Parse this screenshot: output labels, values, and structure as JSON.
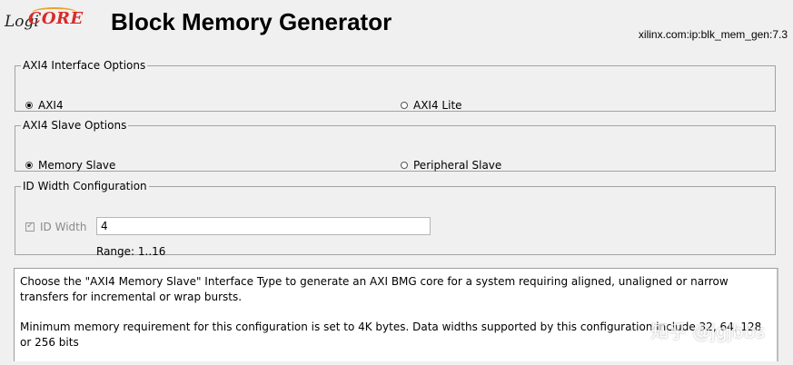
{
  "header": {
    "logo_logi": "Logi",
    "logo_core": "CORE",
    "title": "Block Memory Generator",
    "vlnv": "xilinx.com:ip:blk_mem_gen:7.3"
  },
  "axi4_interface": {
    "legend": "AXI4 Interface Options",
    "options": [
      {
        "label": "AXI4",
        "selected": true
      },
      {
        "label": "AXI4 Lite",
        "selected": false
      }
    ]
  },
  "axi4_slave": {
    "legend": "AXI4 Slave Options",
    "options": [
      {
        "label": "Memory Slave",
        "selected": true
      },
      {
        "label": "Peripheral Slave",
        "selected": false
      }
    ]
  },
  "id_width": {
    "legend": "ID Width Configuration",
    "checkbox_label": "ID Width",
    "checked": true,
    "enabled": false,
    "value": "4",
    "range": "Range: 1..16"
  },
  "info": {
    "paragraph1": "Choose the \"AXI4 Memory Slave\" Interface Type to generate an AXI BMG core for a system requiring aligned, unaligned or narrow transfers for incremental or wrap bursts.",
    "paragraph2": "Minimum memory requirement for this configuration is set to 4K bytes. Data widths supported  by this configuration include 32, 64, 128 or 256 bits"
  },
  "watermark": "知乎 @jgjbbs"
}
